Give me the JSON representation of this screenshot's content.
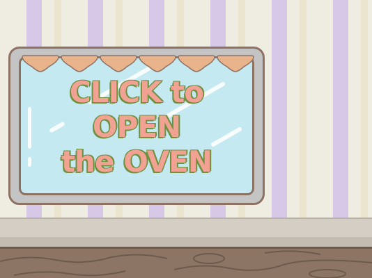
{
  "scene": {
    "palette": {
      "wall_base": "#efece2",
      "wall_stripe": "#d8c8e8",
      "oven_frame": "#c4c4c4",
      "oven_glass": "#c5e9f0",
      "scallop": "#e9b38c",
      "text_fill": "#f2a293",
      "text_outline": "#6d9140",
      "counter": "#d4cec4",
      "wood": "#8c7565"
    }
  },
  "oven": {
    "label_lines": [
      "CLICK to",
      "OPEN",
      "the OVEN"
    ]
  }
}
